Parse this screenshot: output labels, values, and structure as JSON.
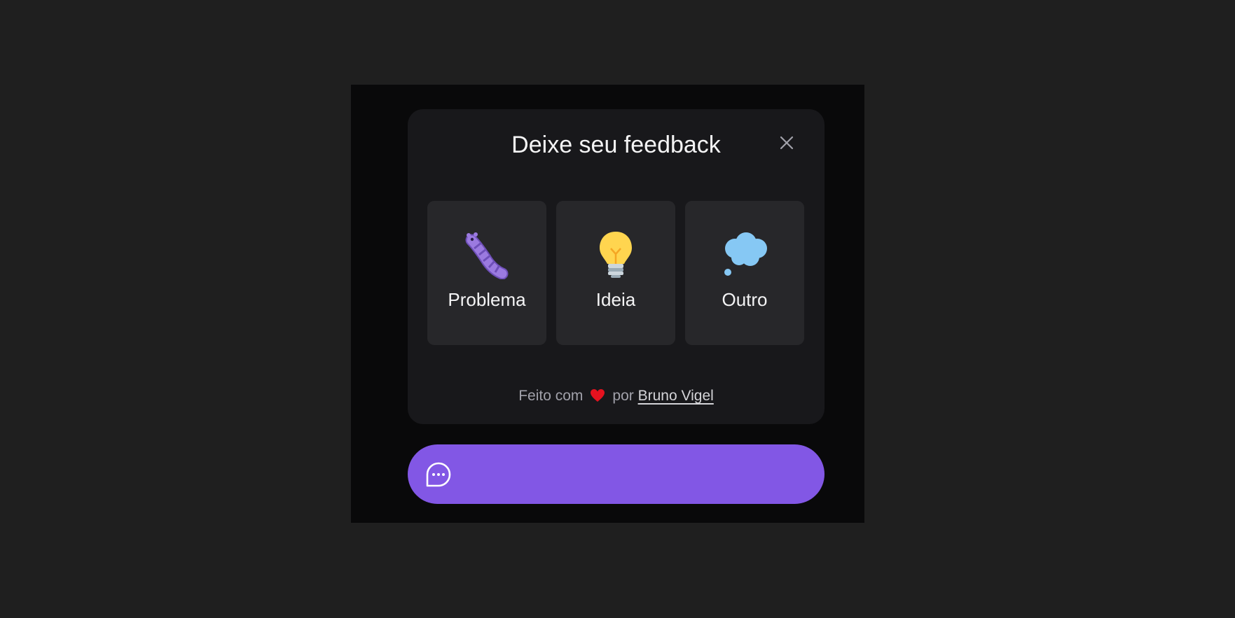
{
  "widget": {
    "title": "Deixe seu feedback",
    "close_icon": "close-icon",
    "options": [
      {
        "label": "Problema",
        "icon": "bug-icon"
      },
      {
        "label": "Ideia",
        "icon": "lightbulb-icon"
      },
      {
        "label": "Outro",
        "icon": "thought-balloon-icon"
      }
    ],
    "footer": {
      "prefix": "Feito com",
      "heart_icon": "heart-icon",
      "middle": "por",
      "author": "Bruno Vigel"
    }
  },
  "launcher": {
    "icon": "chat-teardrop-dots-icon"
  },
  "colors": {
    "page_background": "#1f1f1f",
    "viewport_background": "#09090a",
    "panel_background": "#18181b",
    "option_background": "#27272a",
    "brand": "#8257e5",
    "text_primary": "#f4f4f5",
    "text_secondary": "#a1a1aa"
  }
}
